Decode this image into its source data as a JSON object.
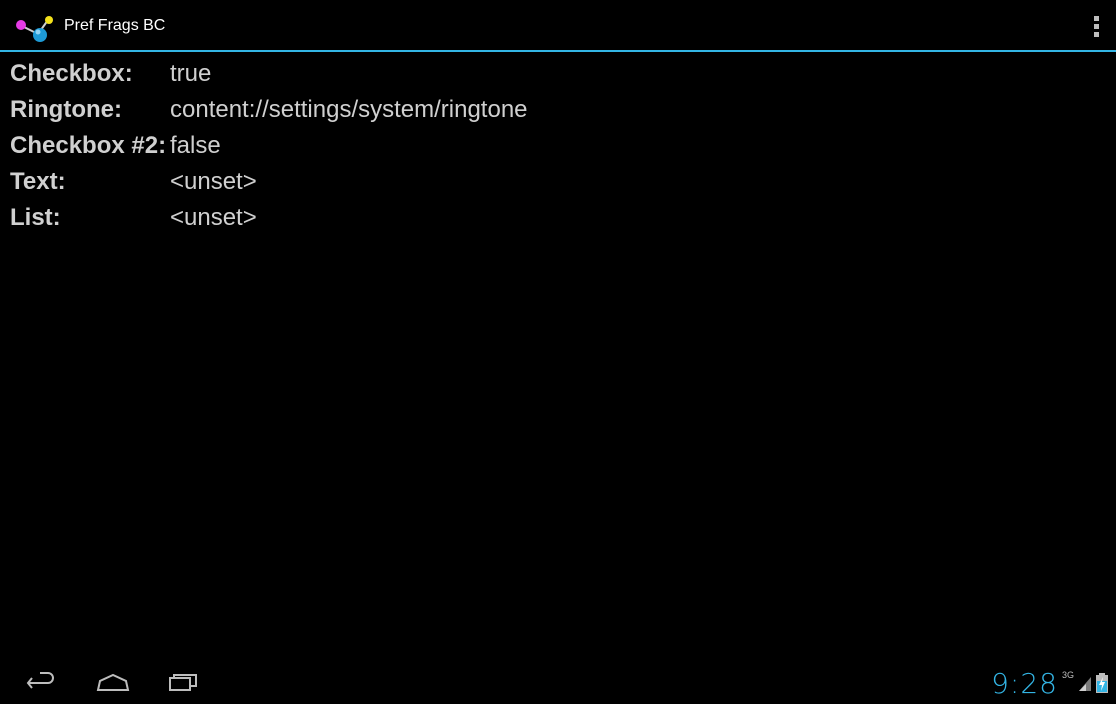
{
  "app": {
    "title": "Pref Frags BC",
    "accent_color": "#33b5e5",
    "logo_icon": "molecule-logo-icon",
    "overflow_icon": "overflow-menu-icon"
  },
  "preferences": [
    {
      "label": "Checkbox:",
      "value": "true"
    },
    {
      "label": "Ringtone:",
      "value": "content://settings/system/ringtone"
    },
    {
      "label": "Checkbox #2:",
      "value": "false"
    },
    {
      "label": "Text:",
      "value": "<unset>"
    },
    {
      "label": "List:",
      "value": "<unset>"
    }
  ],
  "system_bar": {
    "clock": "9:28",
    "network_type": "3G",
    "icons": [
      "back-icon",
      "home-icon",
      "recents-icon",
      "signal-icon",
      "battery-charging-icon"
    ]
  }
}
